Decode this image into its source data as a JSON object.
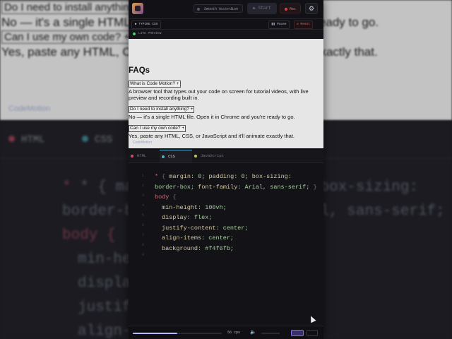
{
  "background": {
    "faq_lines": [
      "Do I need to install anything? +",
      "No — it's a single HTML file. Open it in Chrome and you're ready to go.",
      "Can I use my own code? +",
      "Yes, paste any HTML, CSS, or JavaScript and it'll animate exactly that."
    ],
    "credit": "CodeMotion",
    "tabs": [
      "HTML",
      "CSS"
    ],
    "code_lines": [
      "* { margin: 0; padding: 0; box-sizing:",
      "border-box; font-family: Arial, sans-serif; }",
      "body {",
      "min-height: 100vh;",
      "display: flex;",
      "justify-content: center;",
      "align-items: center;"
    ]
  },
  "toolbar": {
    "animation_select": "Smooth Accordion",
    "start_label": "▶ Start",
    "rec_label": "Rec",
    "settings_icon": "gear-icon"
  },
  "status": {
    "mode": "▶ TYPING CSS",
    "pause_label": "❚❚ Pause",
    "reset_label": "↺ Reset"
  },
  "preview": {
    "header_label": "LIVE PREVIEW",
    "title": "FAQs",
    "faqs": [
      {
        "q": "What is Code Motion? +",
        "a": "A browser tool that types out your code on screen for tutorial videos, with live preview and recording built in."
      },
      {
        "q": "Do I need to install anything? +",
        "a": "No — it's a single HTML file. Open it in Chrome and you're ready to go."
      },
      {
        "q": "Can I use my own code? +",
        "a": "Yes, paste any HTML, CSS, or JavaScript and it'll animate exactly that."
      }
    ],
    "credit": "CodeMotion"
  },
  "editor": {
    "tabs": [
      {
        "label": "HTML",
        "color": "#d84a6a",
        "active": false
      },
      {
        "label": "CSS",
        "color": "#4fb0c8",
        "active": true
      },
      {
        "label": "JavaScript",
        "color": "#c8c84a",
        "active": false
      }
    ],
    "line_numbers": [
      "1",
      "2",
      "3",
      "4",
      "5",
      "6",
      "7",
      "8",
      "9"
    ],
    "code": {
      "l1_sel": "* ",
      "l1_pun": "{ ",
      "l1_p1": "margin",
      "l1_v1": ": 0; ",
      "l1_p2": "padding",
      "l1_v2": ": 0; ",
      "l1_p3": "box-sizing",
      "l1_v3": ":",
      "l2_v": "border-box; ",
      "l2_p": "font-family",
      "l2_v2": ": Arial, sans-serif; ",
      "l2_pun": "}",
      "l3_sel": "body ",
      "l3_pun": "{",
      "l4_p": "min-height",
      "l4_v": ": 100vh;",
      "l5_p": "display",
      "l5_v": ": flex;",
      "l6_p": "justify-content",
      "l6_v": ": center;",
      "l7_p": "align-items",
      "l7_v": ": center;",
      "l8_p": "background",
      "l8_v": ": #f4f6fb;"
    }
  },
  "bottom": {
    "progress_fraction": 0.5,
    "speed": "56 cps",
    "volume_icon": "speaker-icon"
  }
}
